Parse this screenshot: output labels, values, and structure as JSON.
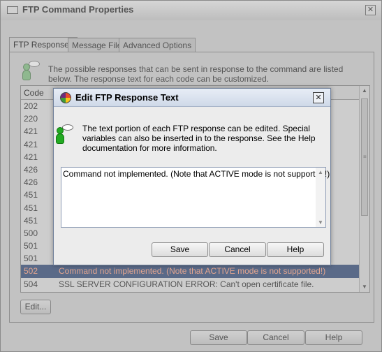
{
  "parent": {
    "title": "FTP Command Properties",
    "close_glyph": "✕",
    "tabs": [
      {
        "label": "FTP Responses"
      },
      {
        "label": "Message File"
      },
      {
        "label": "Advanced Options"
      }
    ],
    "description": "The possible responses that can be sent in response to the command are listed below. The response text for each code can be customized.",
    "table": {
      "columns": [
        "Code"
      ],
      "rows": [
        {
          "code": "202",
          "message": ""
        },
        {
          "code": "220",
          "message": ""
        },
        {
          "code": "421",
          "message": ""
        },
        {
          "code": "421",
          "message": ""
        },
        {
          "code": "421",
          "message": ""
        },
        {
          "code": "426",
          "message": ""
        },
        {
          "code": "426",
          "message": ""
        },
        {
          "code": "451",
          "message": ""
        },
        {
          "code": "451",
          "message": ""
        },
        {
          "code": "451",
          "message": ""
        },
        {
          "code": "500",
          "message": ""
        },
        {
          "code": "501",
          "message": ""
        },
        {
          "code": "501",
          "message": ""
        },
        {
          "code": "502",
          "message": "Command not implemented. (Note that ACTIVE mode is not supported!)"
        },
        {
          "code": "504",
          "message": "SSL SERVER CONFIGURATION ERROR: Can't open certificate file."
        }
      ]
    },
    "edit_button": "Edit...",
    "buttons": {
      "save": "Save",
      "cancel": "Cancel",
      "help": "Help"
    }
  },
  "dialog": {
    "title": "Edit FTP Response Text",
    "close_glyph": "✕",
    "description": "The text portion of each FTP response can be edited. Special variables can also be inserted in to the response. See the Help documentation for more information.",
    "response_text": "Command not implemented. (Note that ACTIVE mode is not supported!)",
    "buttons": {
      "save": "Save",
      "cancel": "Cancel",
      "help": "Help"
    }
  },
  "colors": {
    "selected_row_bg": "#5a6a88",
    "selected_row_text": "#e3a690",
    "info_icon_green": "#22aa22"
  },
  "icons": [
    "window-icon",
    "close-icon",
    "info-person-icon",
    "app-logo-icon",
    "scroll-up-icon",
    "scroll-down-icon"
  ]
}
